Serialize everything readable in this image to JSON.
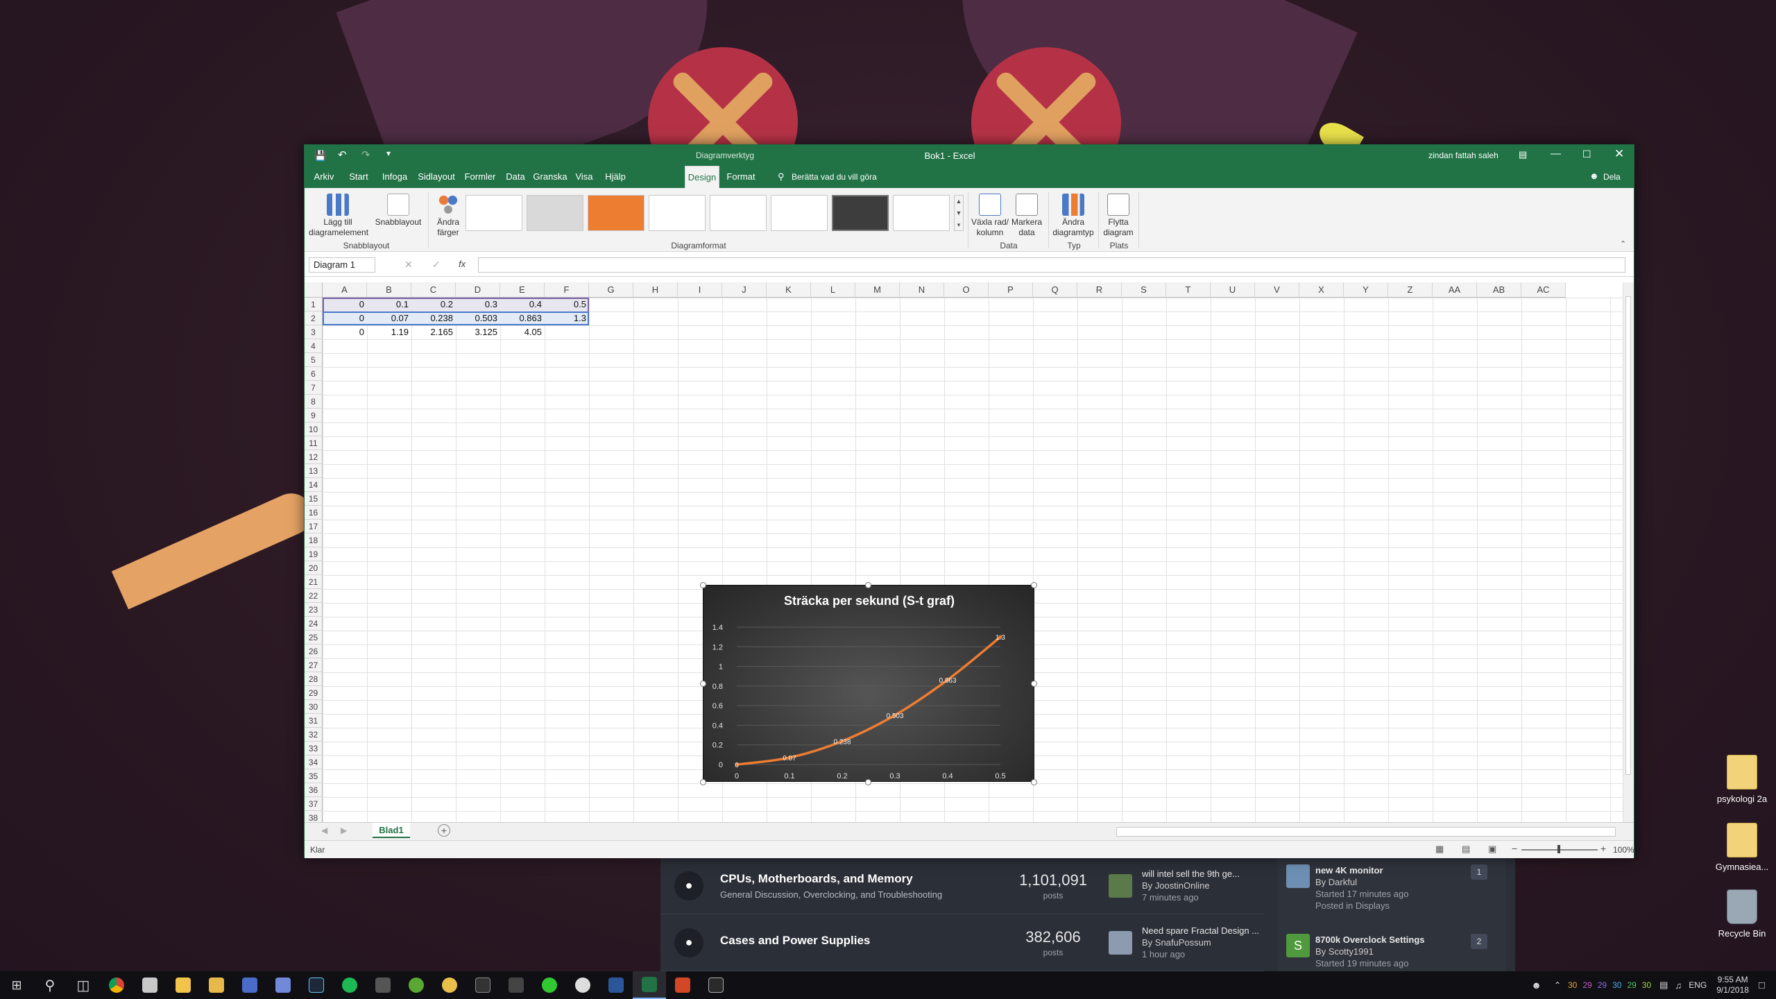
{
  "desktop_icons": [
    {
      "label": "psykologi 2a",
      "icon": "folder-icon"
    },
    {
      "label": "Gymnasiea...",
      "icon": "folder-icon"
    },
    {
      "label": "Recycle Bin",
      "icon": "recycle-bin-icon"
    }
  ],
  "forum": {
    "rows": [
      {
        "title": "CPUs, Motherboards, and Memory",
        "subtitle": "General Discussion, Overclocking, and Troubleshooting",
        "count": "1,101,091",
        "count_label": "posts",
        "last_topic": "will intel sell the 9th ge...",
        "last_by": "By JoostinOnline",
        "last_ago": "7 minutes ago"
      },
      {
        "title": "Cases and Power Supplies",
        "subtitle": "",
        "count": "382,606",
        "count_label": "posts",
        "last_topic": "Need spare Fractal Design ...",
        "last_by": "By SnafuPossum",
        "last_ago": "1 hour ago"
      }
    ],
    "side": [
      {
        "title": "new 4K monitor",
        "by": "By Darkful",
        "started": "Started 17 minutes ago",
        "posted": "Posted in Displays",
        "count": "1"
      },
      {
        "title": "8700k Overclock Settings",
        "by": "By Scotty1991",
        "started": "Started 19 minutes ago",
        "posted": "",
        "count": "2",
        "avatar_letter": "S"
      }
    ]
  },
  "excel": {
    "title": "Bok1  -  Excel",
    "context_group": "Diagramverktyg",
    "user": "zindan fattah saleh",
    "share": "Dela",
    "tabs": [
      "Arkiv",
      "Start",
      "Infoga",
      "Sidlayout",
      "Formler",
      "Data",
      "Granska",
      "Visa",
      "Hjälp",
      "Design",
      "Format"
    ],
    "active_tab": "Design",
    "search_hint": "Berätta vad du vill göra",
    "ribbon": {
      "add_element": "Lägg till diagramelement",
      "quick_layout": "Snabblayout",
      "change_colors": "Ändra färger",
      "switch_rowcol": "Växla rad/ kolumn",
      "select_data": "Markera data",
      "change_type": "Ändra diagramtyp",
      "move_chart": "Flytta diagram",
      "groups": {
        "layouts": "Snabblayout",
        "styles": "Diagramformat",
        "data": "Data",
        "type": "Typ",
        "location": "Plats"
      }
    },
    "name_box": "Diagram 1",
    "fx": "fx",
    "columns": [
      "A",
      "B",
      "C",
      "D",
      "E",
      "F",
      "G",
      "H",
      "I",
      "J",
      "K",
      "L",
      "M",
      "N",
      "O",
      "P",
      "Q",
      "R",
      "S",
      "T",
      "U",
      "V",
      "X",
      "Y",
      "Z",
      "AA",
      "AB",
      "AC"
    ],
    "rows_visible": 38,
    "cells": [
      [
        "0",
        "0.1",
        "0.2",
        "0.3",
        "0.4",
        "0.5"
      ],
      [
        "0",
        "0.07",
        "0.238",
        "0.503",
        "0.863",
        "1.3"
      ],
      [
        "0",
        "1.19",
        "2.165",
        "3.125",
        "4.05",
        ""
      ]
    ],
    "sheet_tab": "Blad1",
    "status": "Klar",
    "zoom": "100%"
  },
  "chart_data": {
    "type": "line",
    "title": "Sträcka per sekund (S-t graf)",
    "x": [
      0,
      0.1,
      0.2,
      0.3,
      0.4,
      0.5
    ],
    "x_tick_labels": [
      "0",
      "0.1",
      "0.2",
      "0.3",
      "0.4",
      "0.5"
    ],
    "series": [
      {
        "values": [
          0,
          0.07,
          0.238,
          0.503,
          0.863,
          1.3
        ]
      }
    ],
    "data_labels": [
      "0",
      "0.07",
      "0.238",
      "0.503",
      "0.863",
      "1.3"
    ],
    "ylim": [
      0,
      1.4
    ],
    "y_ticks": [
      "0",
      "0.2",
      "0.4",
      "0.6",
      "0.8",
      "1",
      "1.2",
      "1.4"
    ],
    "grid": true,
    "xlabel": "",
    "ylabel": "",
    "colors": {
      "line": "#ed7d31",
      "background": "#3a3a3a",
      "text": "#ffffff"
    }
  },
  "taskbar": {
    "clock_time": "9:55 AM",
    "clock_date": "9/1/2018",
    "lang": "ENG",
    "tray_numbers": [
      "30",
      "29",
      "29",
      "30",
      "29",
      "30"
    ]
  }
}
